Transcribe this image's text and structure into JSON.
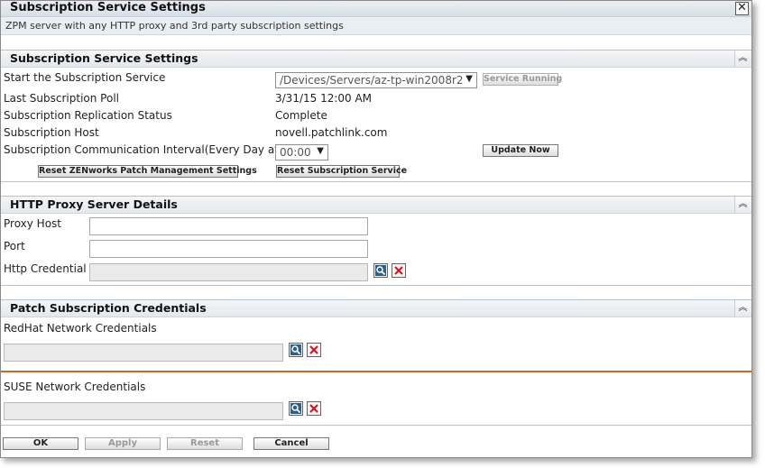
{
  "dialog": {
    "title": "Subscription Service Settings",
    "subtitle": "ZPM server with any HTTP proxy and 3rd party subscription settings"
  },
  "subscription_section": {
    "title": "Subscription Service Settings",
    "start_label": "Start the Subscription Service",
    "server_select_value": "/Devices/Servers/az-tp-win2008r2",
    "service_running_label": "Service Running",
    "last_poll_label": "Last Subscription Poll",
    "last_poll_value": "3/31/15 12:00 AM",
    "replication_label": "Subscription Replication Status",
    "replication_value": "Complete",
    "host_label": "Subscription Host",
    "host_value": "novell.patchlink.com",
    "interval_label": "Subscription Communication Interval(Every Day at)",
    "interval_value": "00:00",
    "update_now_label": "Update Now",
    "reset_zpm_label": "Reset ZENworks Patch Management Settings",
    "reset_subscription_label": "Reset Subscription Service"
  },
  "proxy_section": {
    "title": "HTTP Proxy Server Details",
    "proxy_host_label": "Proxy Host",
    "proxy_host_value": "",
    "port_label": "Port",
    "port_value": "",
    "credential_label": "Http Credential",
    "credential_value": ""
  },
  "credentials_section": {
    "title": "Patch Subscription Credentials",
    "redhat_label": "RedHat Network Credentials",
    "redhat_value": "",
    "suse_label": "SUSE Network Credentials",
    "suse_value": ""
  },
  "footer": {
    "ok_label": "OK",
    "apply_label": "Apply",
    "reset_label": "Reset",
    "cancel_label": "Cancel"
  },
  "icons": {
    "close": "close-icon",
    "collapse": "chevron-up-icon",
    "browse": "magnifier-icon",
    "clear": "x-icon",
    "dropdown": "chevron-down-icon"
  }
}
